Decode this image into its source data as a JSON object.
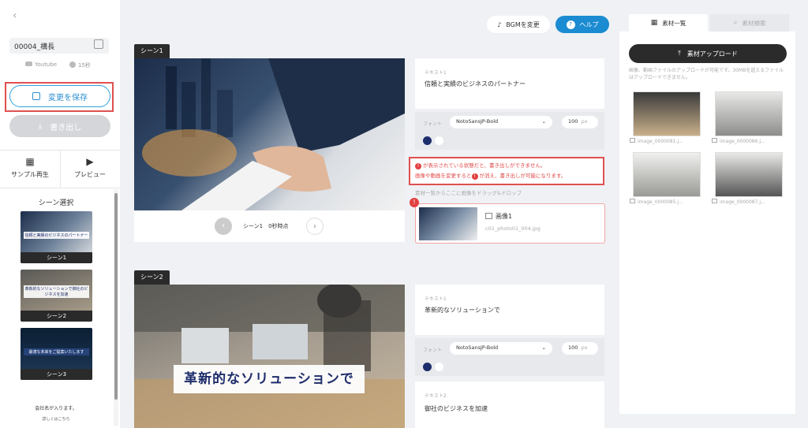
{
  "sidebar": {
    "back_glyph": "‹",
    "project_name": "00004_構長",
    "youtube": "Youtube",
    "duration": "15秒",
    "save_label": "変更を保存",
    "export_label": "書き出し",
    "tool_sample": "サンプル再生",
    "tool_preview": "プレビュー",
    "scene_select_title": "シーン選択",
    "thumbs": [
      {
        "caption": "シーン1",
        "overlay": "信頼と実績のビジネスのパートナー"
      },
      {
        "caption": "シーン2",
        "overlay": "革新的なソリューションで御社のビジネスを加速"
      },
      {
        "caption": "シーン3",
        "overlay": "最適な未来をご提案いたします"
      }
    ],
    "company_text": "会社名が入ります。",
    "company_sub": "詳しくはこちら"
  },
  "header": {
    "bgm_label": "BGMを変更",
    "help_label": "ヘルプ",
    "help_glyph": "?"
  },
  "scenes": [
    {
      "label": "シーン1",
      "nav_text": "シーン1　0秒時点",
      "text_label": "テキスト1",
      "text_value": "信頼と実績のビジネスのパートナー",
      "font_label": "フォント",
      "font_name": "NotoSansJP-Bold",
      "font_size": "100",
      "font_unit": "px",
      "warn_line1": "が表示されている状態だと、書き出しができません。",
      "warn_line2_a": "画像や動画を変更すると",
      "warn_line2_b": "が消え、書き出しが可能になります。",
      "drag_hint": "素材一覧からここに画像をドラッグ&ドロップ",
      "media_name": "画像1",
      "media_file": "c01_photo01_004.jpg"
    },
    {
      "label": "シーン2",
      "caption": "革新的なソリューションで",
      "text_label": "テキスト1",
      "text_value": "革新的なソリューションで",
      "font_label": "フォント",
      "font_name": "NotoSansJP-Bold",
      "font_size": "100",
      "font_unit": "px",
      "text2_label": "テキスト2",
      "text2_value": "御社のビジネスを加速"
    }
  ],
  "assets_panel": {
    "tab_list": "素材一覧",
    "tab_search": "素材検索",
    "upload_label": "素材アップロード",
    "upload_note": "画像、動画ファイルのアップロードが可能です。30MBを超えるファイルはアップロードできません。",
    "assets": [
      {
        "name": "image_0000081.j..."
      },
      {
        "name": "image_0000086.j..."
      },
      {
        "name": "image_0000085.j..."
      },
      {
        "name": "image_0000087.j..."
      }
    ]
  },
  "colors": {
    "accent": "#1b8bd2",
    "warning": "#e24040",
    "navy_swatch": "#1e2d6b",
    "white_swatch": "#ffffff"
  }
}
